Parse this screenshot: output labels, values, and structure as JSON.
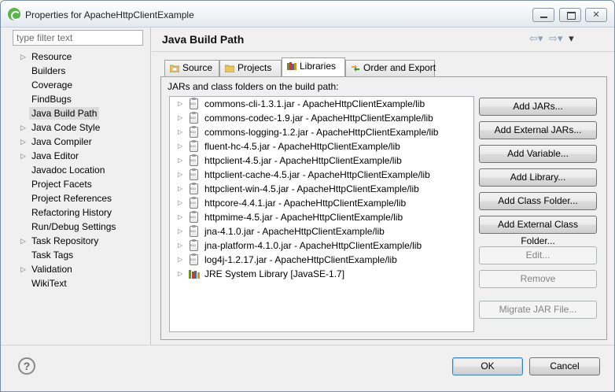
{
  "window": {
    "title": "Properties for ApacheHttpClientExample"
  },
  "filter": {
    "placeholder": "type filter text"
  },
  "tree": [
    {
      "label": "Resource",
      "expandable": true
    },
    {
      "label": "Builders",
      "expandable": false
    },
    {
      "label": "Coverage",
      "expandable": false
    },
    {
      "label": "FindBugs",
      "expandable": false
    },
    {
      "label": "Java Build Path",
      "expandable": false,
      "selected": true
    },
    {
      "label": "Java Code Style",
      "expandable": true
    },
    {
      "label": "Java Compiler",
      "expandable": true
    },
    {
      "label": "Java Editor",
      "expandable": true
    },
    {
      "label": "Javadoc Location",
      "expandable": false
    },
    {
      "label": "Project Facets",
      "expandable": false
    },
    {
      "label": "Project References",
      "expandable": false
    },
    {
      "label": "Refactoring History",
      "expandable": false
    },
    {
      "label": "Run/Debug Settings",
      "expandable": false
    },
    {
      "label": "Task Repository",
      "expandable": true
    },
    {
      "label": "Task Tags",
      "expandable": false
    },
    {
      "label": "Validation",
      "expandable": true
    },
    {
      "label": "WikiText",
      "expandable": false
    }
  ],
  "page": {
    "title": "Java Build Path",
    "nav_back_icon": "back-arrow-icon",
    "nav_forward_icon": "forward-arrow-icon",
    "menu_icon": "view-menu-icon"
  },
  "tabs": [
    {
      "label": "Source",
      "icon": "source-folder-icon"
    },
    {
      "label": "Projects",
      "icon": "projects-folder-icon"
    },
    {
      "label": "Libraries",
      "icon": "libraries-icon",
      "active": true
    },
    {
      "label": "Order and Export",
      "icon": "order-export-icon"
    }
  ],
  "libraries": {
    "caption": "JARs and class folders on the build path:",
    "entries": [
      {
        "label": "commons-cli-1.3.1.jar - ApacheHttpClientExample/lib",
        "icon": "jar-icon"
      },
      {
        "label": "commons-codec-1.9.jar - ApacheHttpClientExample/lib",
        "icon": "jar-icon"
      },
      {
        "label": "commons-logging-1.2.jar - ApacheHttpClientExample/lib",
        "icon": "jar-icon"
      },
      {
        "label": "fluent-hc-4.5.jar - ApacheHttpClientExample/lib",
        "icon": "jar-icon"
      },
      {
        "label": "httpclient-4.5.jar - ApacheHttpClientExample/lib",
        "icon": "jar-icon"
      },
      {
        "label": "httpclient-cache-4.5.jar - ApacheHttpClientExample/lib",
        "icon": "jar-icon"
      },
      {
        "label": "httpclient-win-4.5.jar - ApacheHttpClientExample/lib",
        "icon": "jar-icon"
      },
      {
        "label": "httpcore-4.4.1.jar - ApacheHttpClientExample/lib",
        "icon": "jar-icon"
      },
      {
        "label": "httpmime-4.5.jar - ApacheHttpClientExample/lib",
        "icon": "jar-icon"
      },
      {
        "label": "jna-4.1.0.jar - ApacheHttpClientExample/lib",
        "icon": "jar-icon"
      },
      {
        "label": "jna-platform-4.1.0.jar - ApacheHttpClientExample/lib",
        "icon": "jar-icon"
      },
      {
        "label": "log4j-1.2.17.jar - ApacheHttpClientExample/lib",
        "icon": "jar-icon"
      },
      {
        "label": "JRE System Library [JavaSE-1.7]",
        "icon": "library-icon"
      }
    ]
  },
  "buttons": {
    "add_jars": "Add JARs...",
    "add_external_jars": "Add External JARs...",
    "add_variable": "Add Variable...",
    "add_library": "Add Library...",
    "add_class_folder": "Add Class Folder...",
    "add_external_class_folder": "Add External Class Folder...",
    "edit": "Edit...",
    "remove": "Remove",
    "migrate_jar": "Migrate JAR File..."
  },
  "footer": {
    "help_icon": "help-icon",
    "ok": "OK",
    "cancel": "Cancel"
  }
}
